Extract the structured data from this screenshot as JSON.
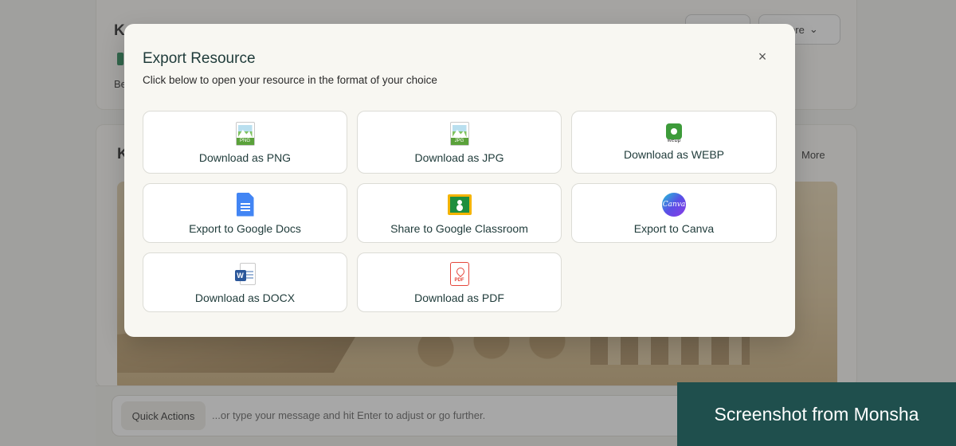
{
  "background": {
    "top_heading": "K",
    "top_text": "Be",
    "more_button": "More",
    "second_heading": "K",
    "more_link": "More",
    "quick_actions": "Quick Actions",
    "input_placeholder": "...or type your message and hit Enter to adjust or go further."
  },
  "modal": {
    "title": "Export Resource",
    "subtitle": "Click below to open your resource in the format of your choice",
    "close": "×",
    "options": [
      {
        "label": "Download as PNG",
        "icon": "png-file-icon"
      },
      {
        "label": "Download as JPG",
        "icon": "jpg-file-icon"
      },
      {
        "label": "Download as WEBP",
        "icon": "webp-icon"
      },
      {
        "label": "Export to Google Docs",
        "icon": "google-docs-icon"
      },
      {
        "label": "Share to Google Classroom",
        "icon": "google-classroom-icon"
      },
      {
        "label": "Export to Canva",
        "icon": "canva-icon"
      },
      {
        "label": "Download as DOCX",
        "icon": "word-docx-icon"
      },
      {
        "label": "Download as PDF",
        "icon": "pdf-file-icon"
      }
    ],
    "icon_tags": {
      "png": "PNG",
      "jpg": "JPG",
      "webp": "webp",
      "canva": "Canva",
      "docx": "W",
      "pdf": "PDF"
    }
  },
  "watermark": "Screenshot from Monsha",
  "colors": {
    "accent": "#1f4f4d",
    "title": "#1f3b3a"
  }
}
